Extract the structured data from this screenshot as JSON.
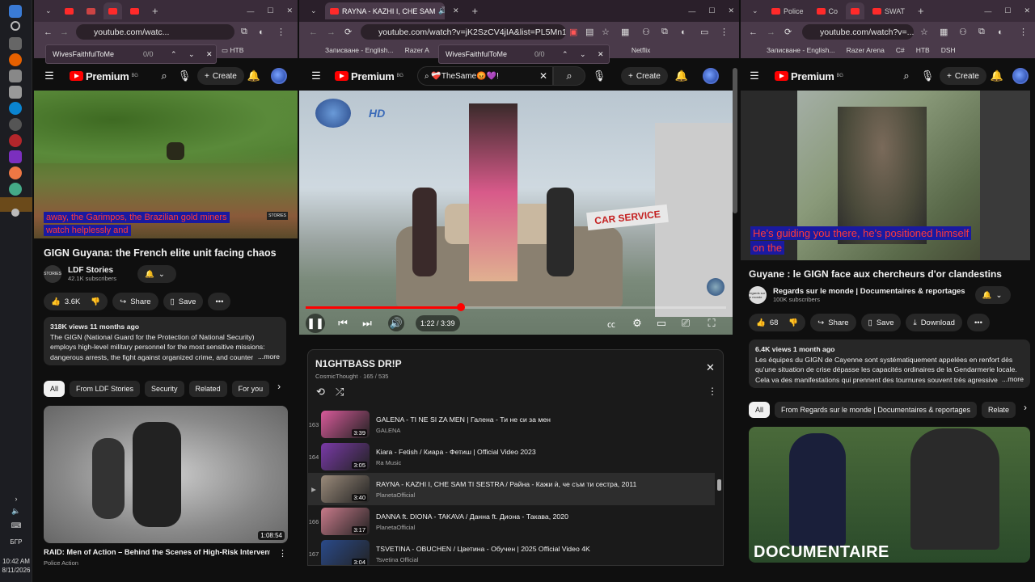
{
  "taskbar": {
    "lang": "БГР",
    "time": "10:42 AM",
    "date": "8/11/2026"
  },
  "left": {
    "url": "youtube.com/watc...",
    "find": {
      "query": "WivesFaithfulToMe",
      "count": "0/0"
    },
    "bookmark": "НТВ",
    "brand": "Premium",
    "region": "BG",
    "create_label": "Create",
    "caption": [
      "away, the Garimpos, the Brazilian gold miners",
      "watch helplessly and"
    ],
    "watermark": "STORIES",
    "title": "GIGN Guyana: the French elite unit facing chaos",
    "channel": {
      "name": "LDF Stories",
      "subs": "42.1K subscribers",
      "avatar": "STORIES"
    },
    "likes": "3.6K",
    "share_label": "Share",
    "save_label": "Save",
    "desc_meta": "318K views  11 months ago",
    "desc_text": "The GIGN (National Guard for the Protection of National Security) employs high-level military personnel for the most sensitive missions: dangerous arrests, the fight against organized crime, and counter",
    "more_label": "...more",
    "chips": [
      "All",
      "From LDF Stories",
      "Security",
      "Related",
      "For you"
    ],
    "next": {
      "duration": "1:08:54",
      "title": "RAID: Men of Action – Behind the Scenes of High-Risk Interventions",
      "channel": "Police Action"
    }
  },
  "center": {
    "tab_title": "RAYNA - KAZHI I, CHE SAM",
    "url": "youtube.com/watch?v=jK2SzCV4jIA&list=PL5Mn1SUkM...",
    "bookmarks": [
      "Записване - English...",
      "Razer A",
      "Netflix"
    ],
    "find": {
      "query": "WivesFaithfulToMe",
      "count": "0/0"
    },
    "brand": "Premium",
    "region": "BG",
    "search_value": "❤️‍🩹TheSame😡💜!",
    "create_label": "Create",
    "hd_logo": "HD",
    "sign": "CAR SERVICE",
    "time": "1:22 / 3:39",
    "progress": 0.37,
    "playlist": {
      "title": "N1GHTBASS DR!P",
      "meta": "CosmicThought · 165 / 535",
      "items": [
        {
          "idx": "163",
          "title": "GALENA - TI NE SI ZA MEN | Галена - Ти не си за мен",
          "channel": "GALENA",
          "dur": "3:39",
          "color": "#d85a9a"
        },
        {
          "idx": "164",
          "title": "Kiara - Fetish / Киара - Фетиш | Official Video 2023",
          "channel": "Ra Music",
          "dur": "3:05",
          "color": "#7a3aa8"
        },
        {
          "idx": "▶",
          "title": "RAYNA - KAZHI I, CHE SAM TI SESTRA / Райна - Кажи ѝ, че съм ти сестра, 2011",
          "channel": "PlanetaOfficial",
          "dur": "3:40",
          "color": "#9a8a7a"
        },
        {
          "idx": "166",
          "title": "DANNA ft. DIONA - TAKAVA / Данна ft. Диона - Такава, 2020",
          "channel": "PlanetaOfficial",
          "dur": "3:17",
          "color": "#c87a8a"
        },
        {
          "idx": "167",
          "title": "TSVETINA - OBUCHEN / Цветина - Обучен | 2025 Official Video 4K",
          "channel": "Tsvetina Official",
          "dur": "3:04",
          "color": "#2a4a8a"
        }
      ]
    }
  },
  "right": {
    "tabs": [
      "Police",
      "Co",
      "",
      "SWAT"
    ],
    "url": "youtube.com/watch?v=...",
    "bookmarks": [
      "Записване - English...",
      "Razer Arena",
      "C#",
      "НТВ",
      "DSH"
    ],
    "brand": "Premium",
    "region": "BG",
    "create_label": "Create",
    "caption": [
      "He's guiding you there, he's positioned himself",
      "on the"
    ],
    "title": "Guyane : le GIGN face aux chercheurs d'or clandestins",
    "channel": {
      "name": "Regards sur le monde | Documentaires & reportages",
      "subs": "100K subscribers",
      "avatar": "regards sur le monde"
    },
    "likes": "68",
    "share_label": "Share",
    "save_label": "Save",
    "download_label": "Download",
    "desc_meta": "6.4K views  1 month ago",
    "desc_text": "Les équipes du GIGN de Cayenne sont systématiquement appelées en renfort dès qu'une situation de crise dépasse les capacités ordinaires de la Gendarmerie locale. Cela va des manifestations qui prennent des tournures souvent très agressive",
    "more_label": "...more",
    "chips": [
      "All",
      "From Regards sur le monde | Documentaires & reportages",
      "Relate"
    ],
    "thumb_text": "DOCUMENTAIRE"
  }
}
